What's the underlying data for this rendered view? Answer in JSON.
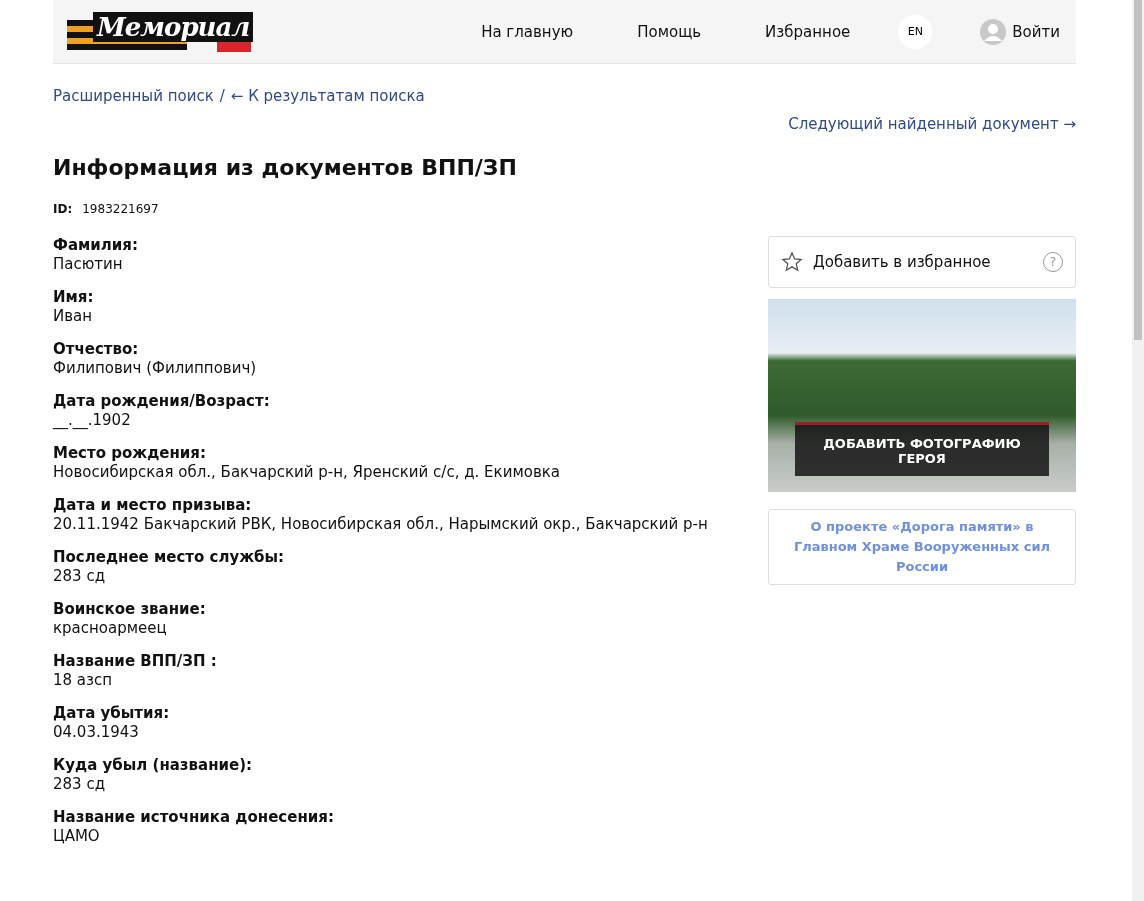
{
  "header": {
    "logo": "Мемориал",
    "nav": [
      "На главную",
      "Помощь",
      "Избранное"
    ],
    "language": "EN",
    "login": "Войти"
  },
  "breadcrumbs": {
    "search": "Расширенный поиск",
    "separator": "/",
    "back": "← К результатам поиска"
  },
  "next_link": "Следующий найденный документ →",
  "title": "Информация из документов ВПП/ЗП",
  "id": {
    "label": "ID:",
    "value": "1983221697"
  },
  "fields": [
    {
      "label": "Фамилия:",
      "value": "Пасютин"
    },
    {
      "label": "Имя:",
      "value": "Иван"
    },
    {
      "label": "Отчество:",
      "value": "Филипович (Филиппович)"
    },
    {
      "label": "Дата рождения/Возраст:",
      "value": "__.__.1902"
    },
    {
      "label": "Место рождения:",
      "value": "Новосибирская обл., Бакчарский р-н, Яренский с/с, д. Екимовка"
    },
    {
      "label": "Дата и место призыва:",
      "value": "20.11.1942 Бакчарский РВК, Новосибирская обл., Нарымский окр., Бакчарский р-н"
    },
    {
      "label": "Последнее место службы:",
      "value": "283 сд"
    },
    {
      "label": "Воинское звание:",
      "value": "красноармеец"
    },
    {
      "label": "Название ВПП/ЗП :",
      "value": "18 азсп"
    },
    {
      "label": "Дата убытия:",
      "value": "04.03.1943"
    },
    {
      "label": "Куда убыл (название):",
      "value": "283 сд"
    },
    {
      "label": "Название источника донесения:",
      "value": "ЦАМО"
    }
  ],
  "sidebar": {
    "favorite": "Добавить в избранное",
    "help": "?",
    "photo_button": "ДОБАВИТЬ ФОТОГРАФИЮ ГЕРОЯ",
    "project_link": "О проекте «Дорога памяти» в Главном Храме Вооруженных сил России"
  }
}
